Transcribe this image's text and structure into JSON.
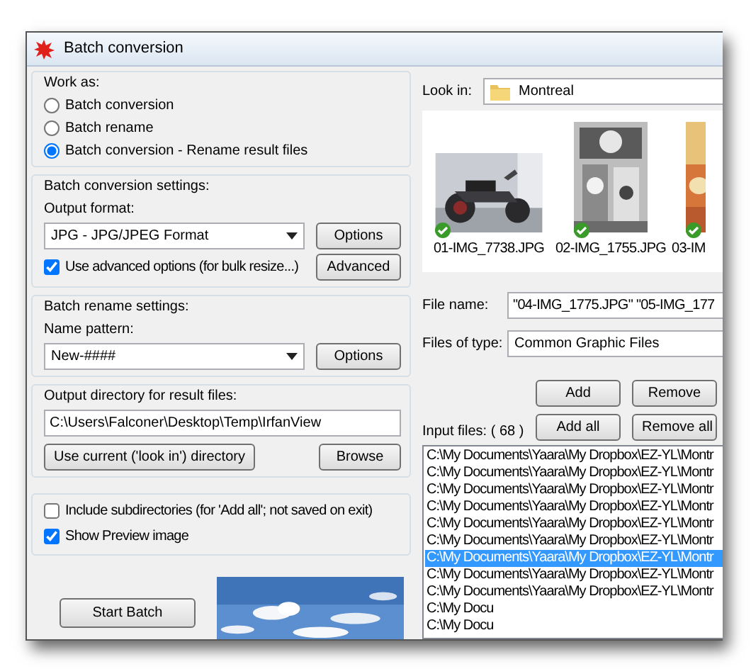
{
  "window": {
    "title": "Batch conversion"
  },
  "work_as": {
    "title": "Work as:",
    "options": [
      {
        "label": "Batch conversion",
        "selected": false
      },
      {
        "label": "Batch rename",
        "selected": false
      },
      {
        "label": "Batch conversion - Rename result files",
        "selected": true
      }
    ]
  },
  "conversion_settings": {
    "title": "Batch conversion settings:",
    "format_label": "Output format:",
    "format": "JPG - JPG/JPEG Format",
    "options_button": "Options",
    "advanced": {
      "label": "Use advanced options (for bulk resize...)",
      "checked": true
    },
    "advanced_button": "Advanced"
  },
  "rename_settings": {
    "title": "Batch rename settings:",
    "pattern_label": "Name pattern:",
    "pattern": "New-####",
    "options_button": "Options"
  },
  "output_directory": {
    "title": "Output directory for result files:",
    "path": "C:\\Users\\Falconer\\Desktop\\Temp\\IrfanView",
    "use_current_button": "Use current ('look in') directory",
    "browse_button": "Browse"
  },
  "flags": [
    {
      "label": "Include subdirectories (for 'Add all'; not saved on exit)",
      "checked": false
    },
    {
      "label": "Show Preview image",
      "checked": true
    }
  ],
  "start_button": "Start Batch",
  "look_in": {
    "label": "Look in:",
    "folder": "Montreal"
  },
  "thumbnails": [
    {
      "file": "01-IMG_7738.JPG",
      "checked": true
    },
    {
      "file": "02-IMG_1755.JPG",
      "checked": true
    },
    {
      "file": "03-IM",
      "checked": true
    }
  ],
  "file_name": {
    "label": "File name:",
    "value": "\"04-IMG_1775.JPG\" \"05-IMG_177"
  },
  "files_of_type": {
    "label": "Files of type:",
    "value": "Common Graphic Files"
  },
  "buttons": [
    "Add",
    "Remove",
    "Add all",
    "Remove all"
  ],
  "input_files": {
    "label": "Input files: ( 68 )",
    "rows": [
      {
        "path": "C:\\My Documents\\Yaara\\My Dropbox\\EZ-YL\\Montr",
        "selected": false
      },
      {
        "path": "C:\\My Documents\\Yaara\\My Dropbox\\EZ-YL\\Montr",
        "selected": false
      },
      {
        "path": "C:\\My Documents\\Yaara\\My Dropbox\\EZ-YL\\Montr",
        "selected": false
      },
      {
        "path": "C:\\My Documents\\Yaara\\My Dropbox\\EZ-YL\\Montr",
        "selected": false
      },
      {
        "path": "C:\\My Documents\\Yaara\\My Dropbox\\EZ-YL\\Montr",
        "selected": false
      },
      {
        "path": "C:\\My Documents\\Yaara\\My Dropbox\\EZ-YL\\Montr",
        "selected": false
      },
      {
        "path": "C:\\My Documents\\Yaara\\My Dropbox\\EZ-YL\\Montr",
        "selected": true
      },
      {
        "path": "C:\\My Documents\\Yaara\\My Dropbox\\EZ-YL\\Montr",
        "selected": false
      },
      {
        "path": "C:\\My Documents\\Yaara\\My Dropbox\\EZ-YL\\Montr",
        "selected": false
      },
      {
        "path": "C:\\My Docu",
        "selected": false
      },
      {
        "path": "C:\\My Docu",
        "selected": false
      }
    ]
  }
}
